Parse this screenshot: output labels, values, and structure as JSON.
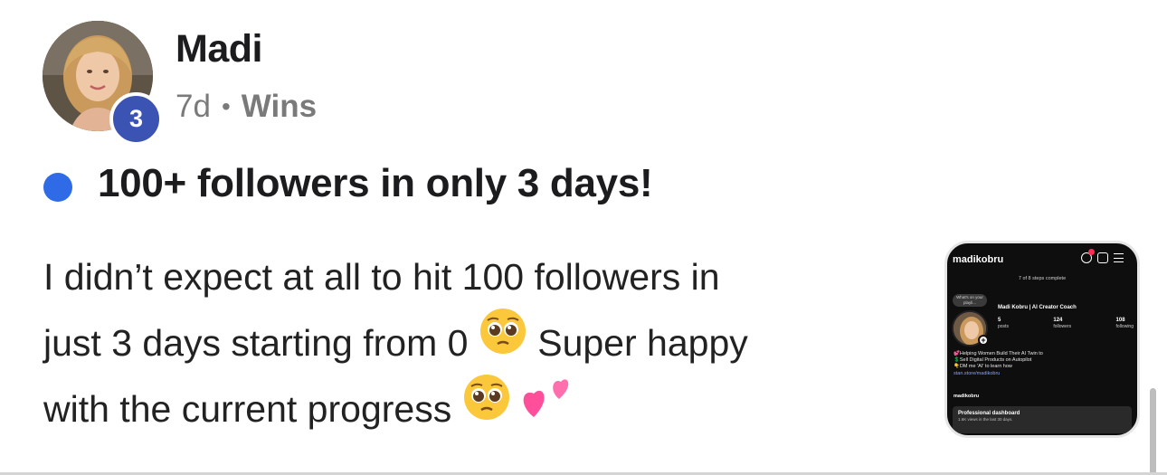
{
  "post": {
    "author": {
      "name": "Madi",
      "level": "3",
      "level_badge_color": "#3b53b3",
      "avatar_icon": "user-avatar-photo"
    },
    "meta": {
      "age": "7d",
      "separator": "•",
      "category": "Wins"
    },
    "unread_dot_color": "#2f6be7",
    "title": "100+ followers in only 3 days!",
    "body": {
      "line1": "I didn’t expect at all to hit 100 followers in",
      "line2_start": "just 3 days starting from 0",
      "line2_end": "Super happy",
      "line3": "with the current progress",
      "emojis": [
        "pleading-face",
        "pleading-face",
        "two-hearts"
      ]
    },
    "attachment": {
      "username": "madikobru",
      "steps": "7 of 8 steps complete",
      "note": "What's on your playli...",
      "display_name": "Madi Kobru | AI Creator Coach",
      "stats": [
        {
          "value": "5",
          "label": "posts"
        },
        {
          "value": "124",
          "label": "followers"
        },
        {
          "value": "108",
          "label": "following"
        }
      ],
      "bio": [
        "💕Helping Women Build Their AI Twin to",
        "💲Sell Digital Products on Autopilot",
        "👇DM me 'AI' to learn how"
      ],
      "link": "stan.store/madikobru",
      "threads_handle": "madikobru",
      "dashboard_title": "Professional dashboard",
      "dashboard_sub": "1.6K views in the last 30 days."
    }
  }
}
